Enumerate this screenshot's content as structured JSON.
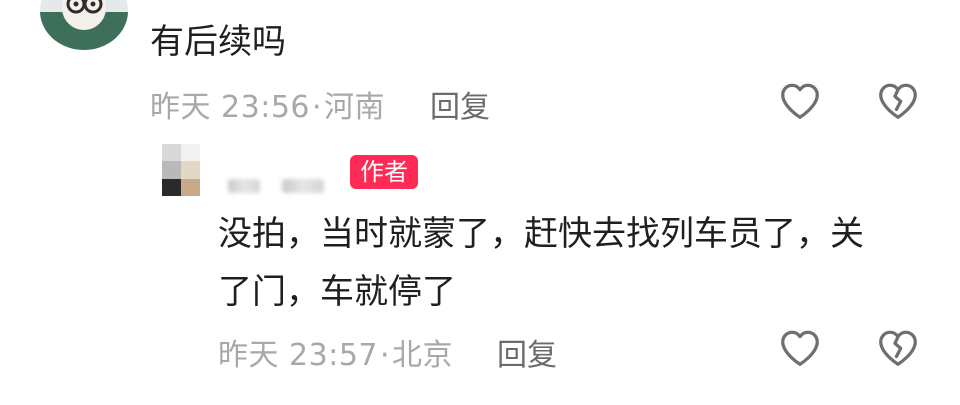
{
  "comment": {
    "text": "有后续吗",
    "time": "昨天 23:56",
    "location": "河南",
    "reply_label": "回复"
  },
  "reply": {
    "badge": "作者",
    "text_line1": "没拍，当时就蒙了，赶快去找列车员了，关",
    "text_line2": "了门，车就停了",
    "time": "昨天 23:57",
    "location": "北京",
    "reply_label": "回复"
  },
  "icons": {
    "like": "heart-outline-icon",
    "dislike": "broken-heart-outline-icon"
  },
  "colors": {
    "badge": "#ff2a55",
    "meta_text": "#a8a8a8",
    "body_text": "#1f1f1f"
  }
}
